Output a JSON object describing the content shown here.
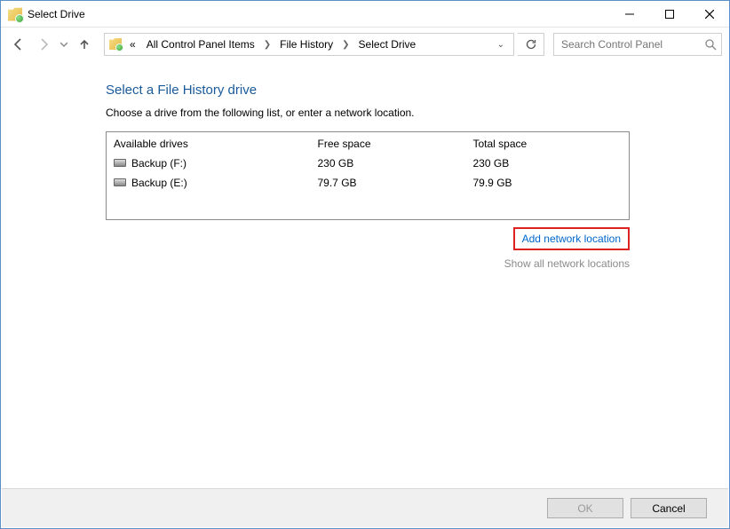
{
  "window": {
    "title": "Select Drive"
  },
  "search": {
    "placeholder": "Search Control Panel"
  },
  "breadcrumb": {
    "prefix": "«",
    "items": [
      "All Control Panel Items",
      "File History",
      "Select Drive"
    ]
  },
  "page": {
    "heading": "Select a File History drive",
    "subtext": "Choose a drive from the following list, or enter a network location."
  },
  "table": {
    "headers": {
      "drive": "Available drives",
      "free": "Free space",
      "total": "Total space"
    },
    "rows": [
      {
        "name": "Backup (F:)",
        "free": "230 GB",
        "total": "230 GB"
      },
      {
        "name": "Backup (E:)",
        "free": "79.7 GB",
        "total": "79.9 GB"
      }
    ]
  },
  "links": {
    "add_network": "Add network location",
    "show_all": "Show all network locations"
  },
  "buttons": {
    "ok": "OK",
    "cancel": "Cancel"
  }
}
